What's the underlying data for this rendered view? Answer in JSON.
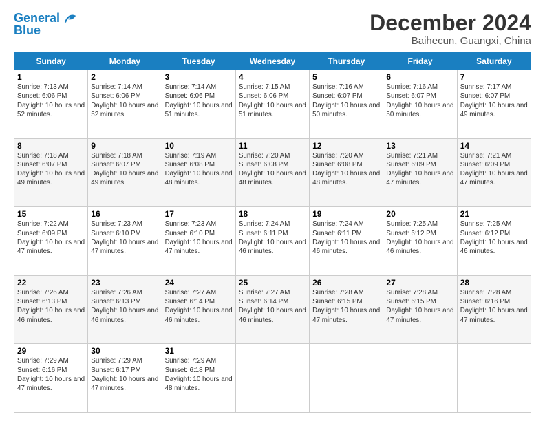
{
  "logo": {
    "line1": "General",
    "line2": "Blue"
  },
  "title": "December 2024",
  "subtitle": "Baihecun, Guangxi, China",
  "headers": [
    "Sunday",
    "Monday",
    "Tuesday",
    "Wednesday",
    "Thursday",
    "Friday",
    "Saturday"
  ],
  "weeks": [
    [
      {
        "day": "1",
        "rise": "7:13 AM",
        "set": "6:06 PM",
        "daylight": "10 hours and 52 minutes."
      },
      {
        "day": "2",
        "rise": "7:14 AM",
        "set": "6:06 PM",
        "daylight": "10 hours and 52 minutes."
      },
      {
        "day": "3",
        "rise": "7:14 AM",
        "set": "6:06 PM",
        "daylight": "10 hours and 51 minutes."
      },
      {
        "day": "4",
        "rise": "7:15 AM",
        "set": "6:06 PM",
        "daylight": "10 hours and 51 minutes."
      },
      {
        "day": "5",
        "rise": "7:16 AM",
        "set": "6:07 PM",
        "daylight": "10 hours and 50 minutes."
      },
      {
        "day": "6",
        "rise": "7:16 AM",
        "set": "6:07 PM",
        "daylight": "10 hours and 50 minutes."
      },
      {
        "day": "7",
        "rise": "7:17 AM",
        "set": "6:07 PM",
        "daylight": "10 hours and 49 minutes."
      }
    ],
    [
      {
        "day": "8",
        "rise": "7:18 AM",
        "set": "6:07 PM",
        "daylight": "10 hours and 49 minutes."
      },
      {
        "day": "9",
        "rise": "7:18 AM",
        "set": "6:07 PM",
        "daylight": "10 hours and 49 minutes."
      },
      {
        "day": "10",
        "rise": "7:19 AM",
        "set": "6:08 PM",
        "daylight": "10 hours and 48 minutes."
      },
      {
        "day": "11",
        "rise": "7:20 AM",
        "set": "6:08 PM",
        "daylight": "10 hours and 48 minutes."
      },
      {
        "day": "12",
        "rise": "7:20 AM",
        "set": "6:08 PM",
        "daylight": "10 hours and 48 minutes."
      },
      {
        "day": "13",
        "rise": "7:21 AM",
        "set": "6:09 PM",
        "daylight": "10 hours and 47 minutes."
      },
      {
        "day": "14",
        "rise": "7:21 AM",
        "set": "6:09 PM",
        "daylight": "10 hours and 47 minutes."
      }
    ],
    [
      {
        "day": "15",
        "rise": "7:22 AM",
        "set": "6:09 PM",
        "daylight": "10 hours and 47 minutes."
      },
      {
        "day": "16",
        "rise": "7:23 AM",
        "set": "6:10 PM",
        "daylight": "10 hours and 47 minutes."
      },
      {
        "day": "17",
        "rise": "7:23 AM",
        "set": "6:10 PM",
        "daylight": "10 hours and 47 minutes."
      },
      {
        "day": "18",
        "rise": "7:24 AM",
        "set": "6:11 PM",
        "daylight": "10 hours and 46 minutes."
      },
      {
        "day": "19",
        "rise": "7:24 AM",
        "set": "6:11 PM",
        "daylight": "10 hours and 46 minutes."
      },
      {
        "day": "20",
        "rise": "7:25 AM",
        "set": "6:12 PM",
        "daylight": "10 hours and 46 minutes."
      },
      {
        "day": "21",
        "rise": "7:25 AM",
        "set": "6:12 PM",
        "daylight": "10 hours and 46 minutes."
      }
    ],
    [
      {
        "day": "22",
        "rise": "7:26 AM",
        "set": "6:13 PM",
        "daylight": "10 hours and 46 minutes."
      },
      {
        "day": "23",
        "rise": "7:26 AM",
        "set": "6:13 PM",
        "daylight": "10 hours and 46 minutes."
      },
      {
        "day": "24",
        "rise": "7:27 AM",
        "set": "6:14 PM",
        "daylight": "10 hours and 46 minutes."
      },
      {
        "day": "25",
        "rise": "7:27 AM",
        "set": "6:14 PM",
        "daylight": "10 hours and 46 minutes."
      },
      {
        "day": "26",
        "rise": "7:28 AM",
        "set": "6:15 PM",
        "daylight": "10 hours and 47 minutes."
      },
      {
        "day": "27",
        "rise": "7:28 AM",
        "set": "6:15 PM",
        "daylight": "10 hours and 47 minutes."
      },
      {
        "day": "28",
        "rise": "7:28 AM",
        "set": "6:16 PM",
        "daylight": "10 hours and 47 minutes."
      }
    ],
    [
      {
        "day": "29",
        "rise": "7:29 AM",
        "set": "6:16 PM",
        "daylight": "10 hours and 47 minutes."
      },
      {
        "day": "30",
        "rise": "7:29 AM",
        "set": "6:17 PM",
        "daylight": "10 hours and 47 minutes."
      },
      {
        "day": "31",
        "rise": "7:29 AM",
        "set": "6:18 PM",
        "daylight": "10 hours and 48 minutes."
      },
      null,
      null,
      null,
      null
    ]
  ]
}
